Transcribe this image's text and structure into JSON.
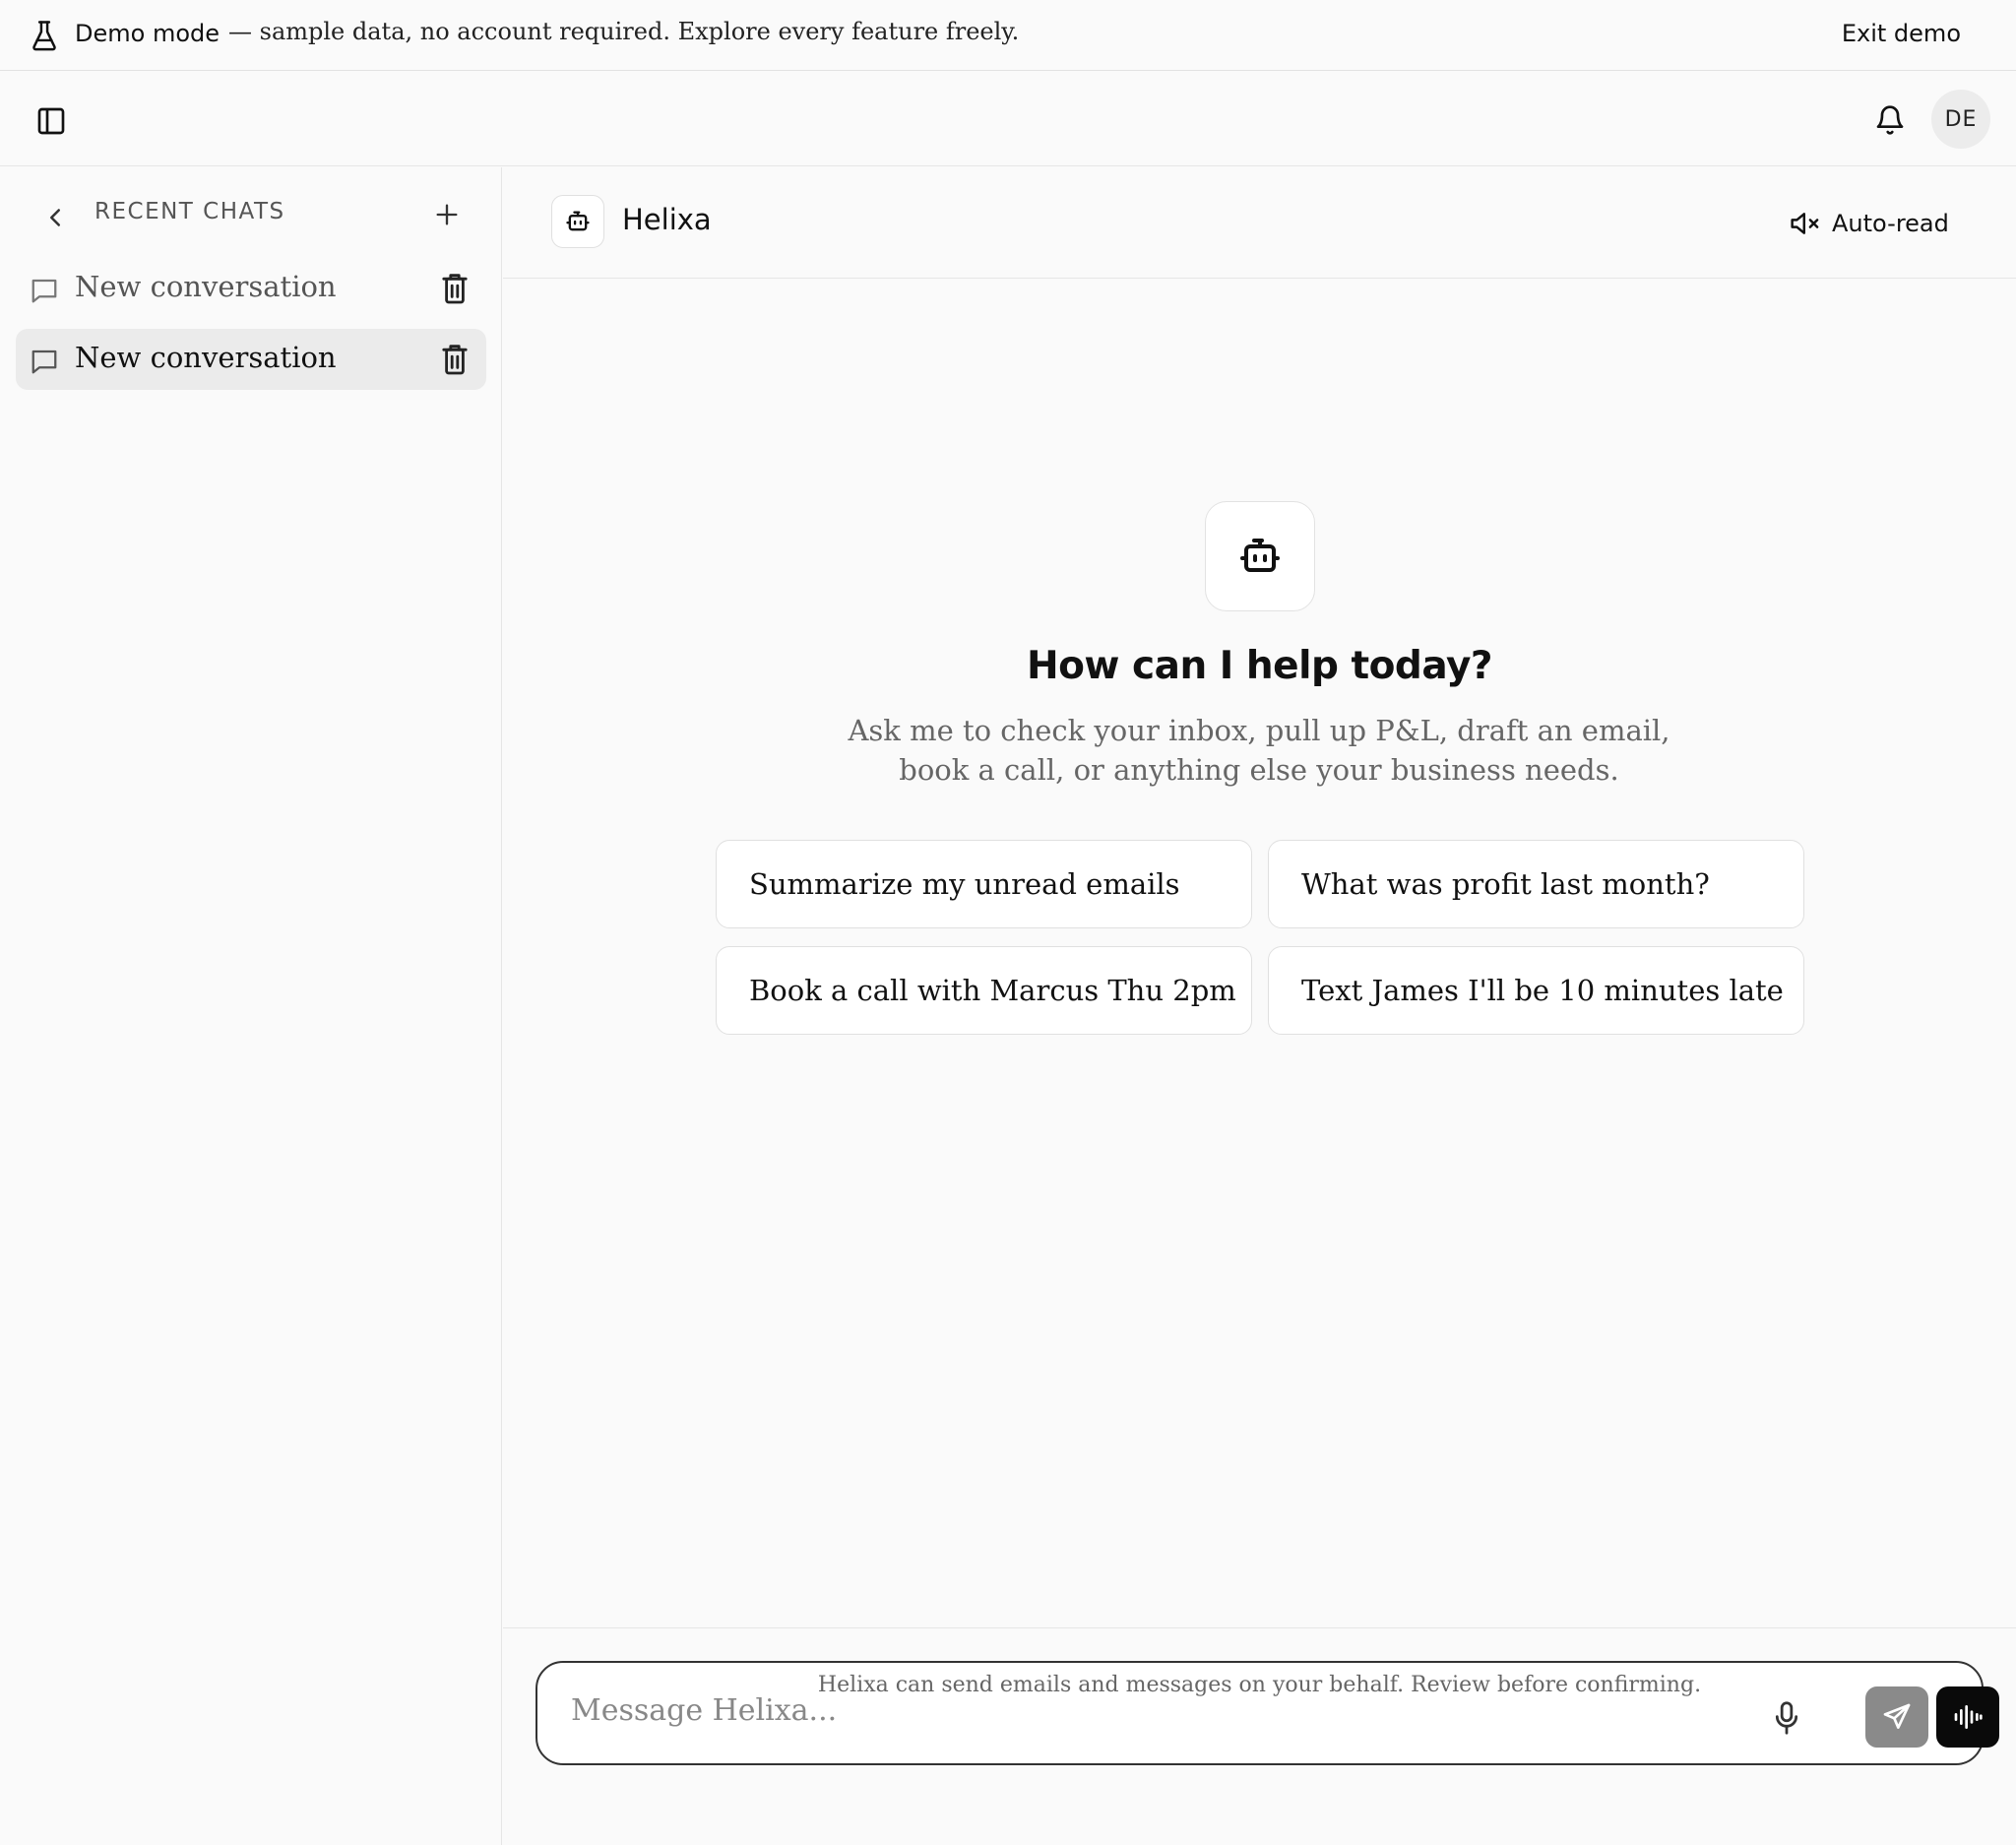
{
  "banner": {
    "mode_label": "Demo mode",
    "message": "— sample data, no account required. Explore every feature freely.",
    "exit_label": "Exit demo"
  },
  "topbar": {
    "avatar_initials": "DE"
  },
  "sidebar": {
    "heading": "RECENT CHATS",
    "chats": [
      {
        "label": "New conversation",
        "active": false,
        "color": "#555555"
      },
      {
        "label": "New conversation",
        "active": true,
        "color": "#111111"
      }
    ]
  },
  "chat": {
    "assistant_name": "Helixa",
    "autoread_label": "Auto-read",
    "empty_title": "How can I help today?",
    "empty_subtitle": "Ask me to check your inbox, pull up P&L, draft an email, book a call, or anything else your business needs.",
    "suggestions": [
      "Summarize my unread emails",
      "What was profit last month?",
      "Book a call with Marcus Thu 2pm",
      "Text James I'll be 10 minutes late"
    ],
    "input_placeholder": "Message Helixa...",
    "disclaimer": "Helixa can send emails and messages on your behalf. Review before confirming."
  },
  "colors": {
    "send_button": "#8a8a8a",
    "voice_button": "#0a0a0a",
    "active_chat_bg": "#ebebeb"
  },
  "icons": [
    "flask-icon",
    "sidebar-toggle-icon",
    "bell-icon",
    "chevron-left-icon",
    "plus-icon",
    "chat-bubble-icon",
    "trash-icon",
    "bot-icon",
    "speaker-muted-icon",
    "mic-icon",
    "send-icon",
    "voice-waveform-icon"
  ]
}
